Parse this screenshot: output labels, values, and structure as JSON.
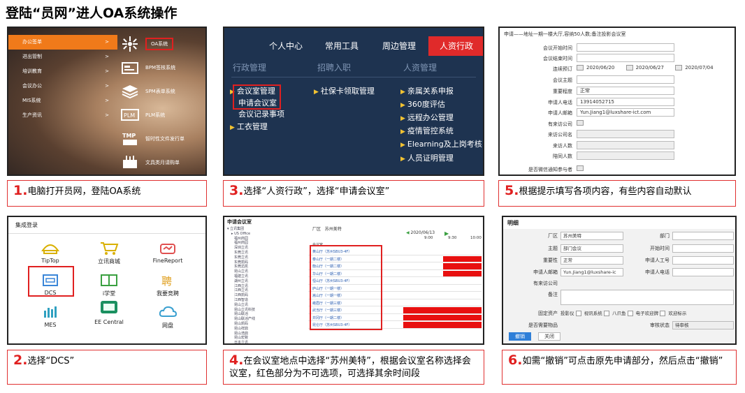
{
  "title": "登陆“员网”进人OA系统操作",
  "panel1": {
    "menu": [
      {
        "label": "办公签单",
        "active": true
      },
      {
        "label": "进出管制",
        "active": false
      },
      {
        "label": "培训教育",
        "active": false
      },
      {
        "label": "会议办公",
        "active": false
      },
      {
        "label": "MIS系统",
        "active": false
      },
      {
        "label": "生产资讯",
        "active": false
      }
    ],
    "arrow": ">",
    "apps": [
      {
        "label": "OA系统",
        "icon": "oa-logo-icon"
      },
      {
        "label": "BPM签核系统",
        "icon": "bpm-icon"
      },
      {
        "label": "SPM表单系统",
        "icon": "spm-icon"
      },
      {
        "label": "PLM系统",
        "icon": "plm-icon"
      },
      {
        "label": "智时性文件发行单",
        "icon": "tmp-icon"
      },
      {
        "label": "文具类月请购单",
        "icon": "stationery-icon"
      }
    ]
  },
  "panel3": {
    "nav": [
      "个人中心",
      "常用工具",
      "周边管理",
      "人资行政"
    ],
    "columns": [
      "行政管理",
      "招聘入职",
      "人资管理"
    ],
    "col1": [
      "会议室管理",
      "申请会议室",
      "会议记录事项",
      "工衣管理"
    ],
    "col2": [
      "社保卡领取管理"
    ],
    "col3": [
      "亲属关系申报",
      "360度评估",
      "远程办公管理",
      "疫情管控系统",
      "Elearning及上岗考核",
      "人员证明管理"
    ]
  },
  "panel5": {
    "header": "申请——地址一期一楼大厅,容纳50人数;备注投影会议室",
    "fields": [
      {
        "label": "会议开始时间",
        "value": ""
      },
      {
        "label": "会议结束时间",
        "value": ""
      },
      {
        "label": "连续预订",
        "value": ""
      },
      {
        "label": "会议主题",
        "value": ""
      },
      {
        "label": "重要程度",
        "value": "正常"
      },
      {
        "label": "申请人电话",
        "value": "13914052715"
      },
      {
        "label": "申请人邮箱",
        "value": "Yun.Jiang1@luxshare-ict.com"
      },
      {
        "label": "有来访公司",
        "value": ""
      },
      {
        "label": "来访公司名",
        "value": ""
      },
      {
        "label": "来访人数",
        "value": ""
      },
      {
        "label": "陪同人数",
        "value": ""
      },
      {
        "label": "是否微信通知参与者",
        "value": ""
      }
    ],
    "dates": [
      "2020/06/20",
      "2020/06/27",
      "2020/07/04"
    ]
  },
  "panel2": {
    "header": "集成登录",
    "icons": [
      {
        "label": "TipTop",
        "icon": "tiptop-icon"
      },
      {
        "label": "立讯商城",
        "icon": "cart-icon"
      },
      {
        "label": "FineReport",
        "icon": "finereport-icon"
      },
      {
        "label": "DCS",
        "icon": "dcs-icon"
      },
      {
        "label": "i学堂",
        "icon": "book-icon"
      },
      {
        "label": "我要竞聘",
        "icon": "hire-icon"
      },
      {
        "label": "MES",
        "icon": "mes-icon"
      },
      {
        "label": "EE Central",
        "icon": "monitor-icon"
      },
      {
        "label": "网盘",
        "icon": "cloud-icon"
      }
    ]
  },
  "panel4": {
    "header": "申请会议室",
    "tree_root": "立讯集团",
    "tree_office": "US Office",
    "tree_items": [
      "福州商园",
      "福州商园",
      "深圳立讯",
      "东莞立讯",
      "东莞立讯",
      "东莞凯码",
      "东莞迅凯",
      "昆山立讯",
      "福建立讯",
      "湖州立讯",
      "江西立讯",
      "江西立讯",
      "江西凯码",
      "江西智造",
      "昆山立讯",
      "昆山立讯科技",
      "昆山联滔",
      "昆山联滔产线",
      "昆山凯码",
      "昆山祥鼎",
      "昆山浩鼎",
      "昆山宏致",
      "日本立讯",
      "苏州立讯",
      "苏州美特",
      "台湾立讯",
      "台湾宣德"
    ],
    "factory_label": "厂区",
    "factory_value": "苏州美特",
    "date": "2020/06/13",
    "times": [
      "9:00",
      "9:30",
      "10:00"
    ],
    "room_header": "会议室",
    "rooms": [
      "黄山厅（苏州SBU3-4F）",
      "泰山厅（一期二楼）",
      "衡山厅（一期二楼）",
      "华山厅（一期二楼）",
      "恒山厅（苏州SBU3-4F）",
      "庐山厅（一期一楼）",
      "嵩山厅（一期一楼）",
      "峨眉厅（一期三楼）",
      "武当厅（一期三楼）",
      "井冈厅（一期二楼）",
      "昆仑厅（苏州SBU3-4F）"
    ]
  },
  "panel6": {
    "header": "明细",
    "factory_label": "厂区",
    "factory_value": "苏州美特",
    "dept_label": "部门",
    "topic_label": "主题",
    "topic_value": "部门会议",
    "start_label": "开始时间",
    "importance_label": "重要性",
    "importance_value": "正常",
    "applicant_no_label": "申请人工号",
    "email_label": "申请人邮箱",
    "email_value": "Yun.Jiang1@luxshare-ic",
    "phone_label": "申请人电话",
    "visitor_label": "有来访公司",
    "note_label": "备注",
    "assets_label": "固定资产",
    "assets": [
      "投影仪",
      "视讯系统",
      "八爪鱼",
      "电子欢迎牌",
      "欢迎标示"
    ],
    "items_label": "是否需要物品",
    "status_label": "审核状态",
    "status_value": "待审核",
    "revoke_button": "撤销",
    "close_button": "关闭"
  },
  "captions": [
    {
      "num": "1.",
      "text": "电脑打开员网，登陆OA系统"
    },
    {
      "num": "2.",
      "text": "选择“DCS”"
    },
    {
      "num": "3.",
      "text": "选择“人资行政”，选择“申请会议室”"
    },
    {
      "num": "4.",
      "text": "在会议室地点中选择“苏州美特”，根据会议室名称选择会议室，红色部分为不可选项，可选择其余时间段"
    },
    {
      "num": "5.",
      "text": "根据提示填写各项内容，有些内容自动默认"
    },
    {
      "num": "6.",
      "text": "如需“撤销”可点击原先申请部分，然后点击“撤销”"
    }
  ]
}
